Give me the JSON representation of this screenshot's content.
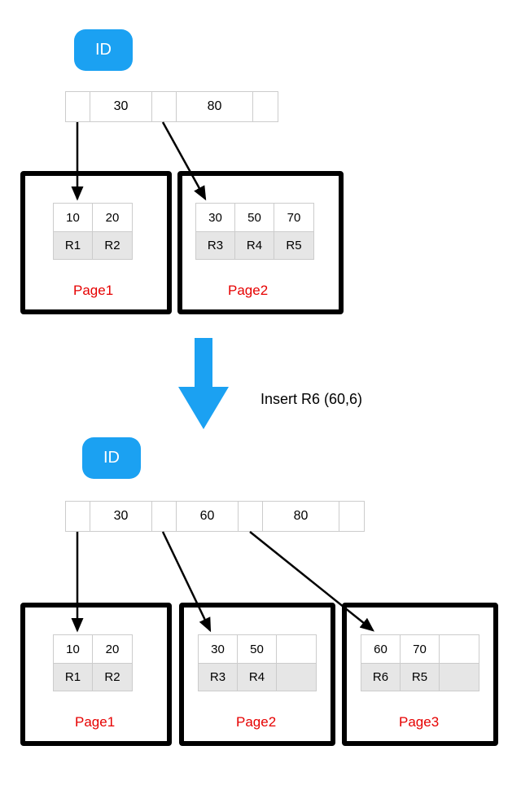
{
  "top": {
    "badge": "ID",
    "root_keys": [
      "30",
      "80"
    ],
    "pages": [
      {
        "label": "Page1",
        "keys": [
          "10",
          "20"
        ],
        "refs": [
          "R1",
          "R2"
        ]
      },
      {
        "label": "Page2",
        "keys": [
          "30",
          "50",
          "70"
        ],
        "refs": [
          "R3",
          "R4",
          "R5"
        ]
      }
    ]
  },
  "insert_text": "Insert R6 (60,6)",
  "bottom": {
    "badge": "ID",
    "root_keys": [
      "30",
      "60",
      "80"
    ],
    "pages": [
      {
        "label": "Page1",
        "keys": [
          "10",
          "20"
        ],
        "refs": [
          "R1",
          "R2"
        ]
      },
      {
        "label": "Page2",
        "keys": [
          "30",
          "50",
          ""
        ],
        "refs": [
          "R3",
          "R4",
          ""
        ]
      },
      {
        "label": "Page3",
        "keys": [
          "60",
          "70",
          ""
        ],
        "refs": [
          "R6",
          "R5",
          ""
        ]
      }
    ]
  },
  "chart_data": {
    "type": "table",
    "title": "B-tree page split on Insert R6 (60,6)",
    "before": {
      "root": [
        30,
        80
      ],
      "pages": [
        {
          "name": "Page1",
          "rows": [
            {
              "key": 10,
              "ref": "R1"
            },
            {
              "key": 20,
              "ref": "R2"
            }
          ]
        },
        {
          "name": "Page2",
          "rows": [
            {
              "key": 30,
              "ref": "R3"
            },
            {
              "key": 50,
              "ref": "R4"
            },
            {
              "key": 70,
              "ref": "R5"
            }
          ]
        }
      ]
    },
    "after": {
      "root": [
        30,
        60,
        80
      ],
      "pages": [
        {
          "name": "Page1",
          "rows": [
            {
              "key": 10,
              "ref": "R1"
            },
            {
              "key": 20,
              "ref": "R2"
            }
          ]
        },
        {
          "name": "Page2",
          "rows": [
            {
              "key": 30,
              "ref": "R3"
            },
            {
              "key": 50,
              "ref": "R4"
            }
          ]
        },
        {
          "name": "Page3",
          "rows": [
            {
              "key": 60,
              "ref": "R6"
            },
            {
              "key": 70,
              "ref": "R5"
            }
          ]
        }
      ]
    }
  }
}
